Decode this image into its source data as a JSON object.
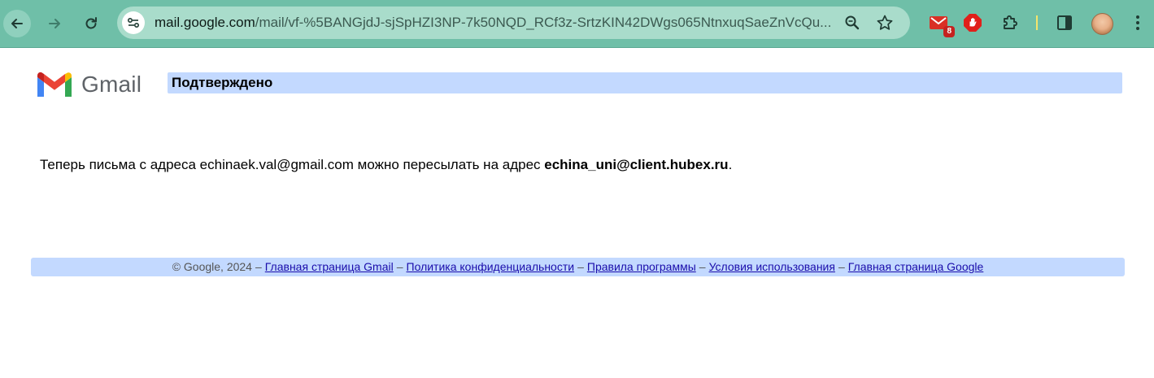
{
  "browser": {
    "url_host": "mail.google.com",
    "url_path": "/mail/vf-%5BANGjdJ-sjSpHZI3NP-7k50NQD_RCf3z-SrtzKIN42DWgs065NtnxuqSaeZnVcQu...",
    "gmail_badge": "8"
  },
  "page": {
    "logo_text": "Gmail",
    "title": "Подтверждено",
    "message_prefix": "Теперь письма с адреса echinaek.val@gmail.com можно пересылать на адрес ",
    "message_address": "echina_uni@client.hubex.ru",
    "message_suffix": "."
  },
  "footer": {
    "copyright": "© Google, 2024",
    "separator": "–",
    "links": [
      "Главная страница Gmail",
      "Политика конфиденциальности",
      "Правила программы",
      "Условия использования",
      "Главная страница Google"
    ]
  },
  "colors": {
    "toolbar": "#6fbfa8",
    "title_bar": "#c3d9ff",
    "link": "#1a0dab"
  }
}
